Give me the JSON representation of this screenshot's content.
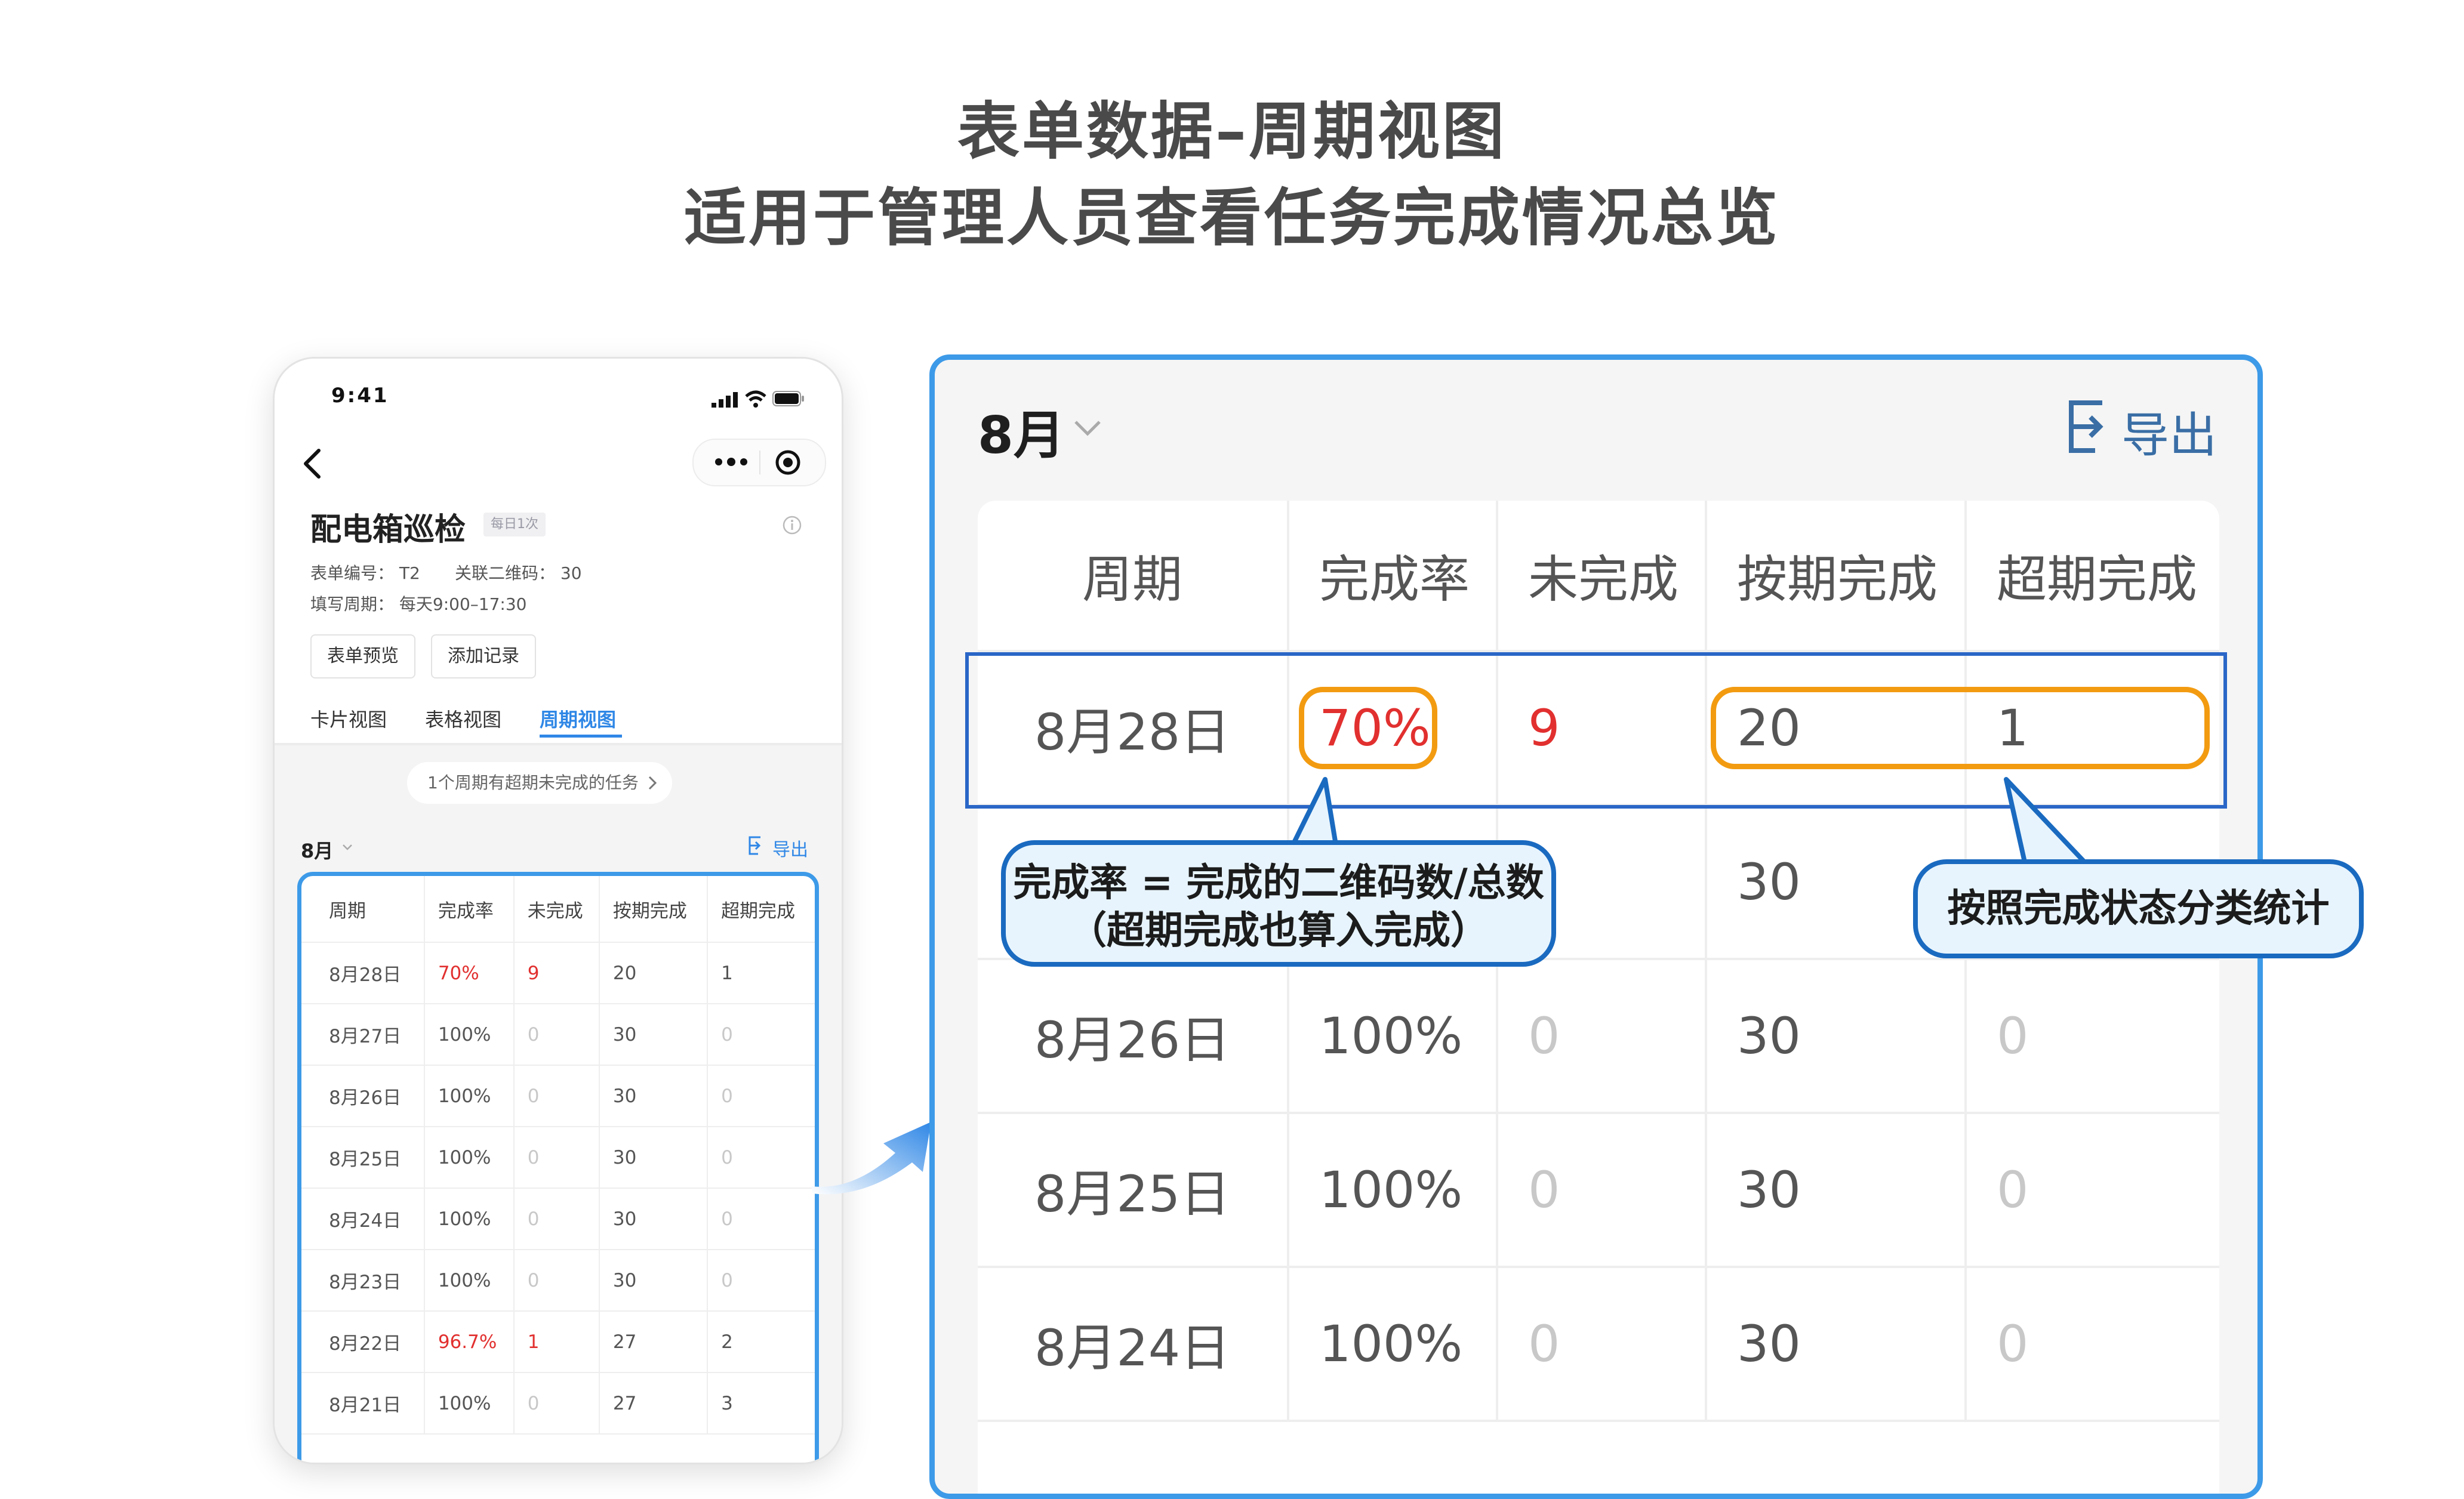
{
  "headline": {
    "line1": "表单数据–周期视图",
    "line2": "适用于管理人员查看任务完成情况总览"
  },
  "phone": {
    "status_time": "9:41",
    "form_title": "配电箱巡检",
    "frequency_badge": "每日1次",
    "form_number": "表单编号： T2",
    "linked_qr": "关联二维码： 30",
    "fill_period": "填写周期： 每天9:00–17:30",
    "buttons": {
      "preview": "表单预览",
      "add_record": "添加记录"
    },
    "tabs": [
      "卡片视图",
      "表格视图",
      "周期视图"
    ],
    "active_tab": "周期视图",
    "notice": "1个周期有超期未完成的任务",
    "month": "8月",
    "export": "导出",
    "table": {
      "headers": [
        "周期",
        "完成率",
        "未完成",
        "按期完成",
        "超期完成"
      ],
      "rows": [
        [
          "8月28日",
          "70%",
          "9",
          "20",
          "1"
        ],
        [
          "8月27日",
          "100%",
          "0",
          "30",
          "0"
        ],
        [
          "8月26日",
          "100%",
          "0",
          "30",
          "0"
        ],
        [
          "8月25日",
          "100%",
          "0",
          "30",
          "0"
        ],
        [
          "8月24日",
          "100%",
          "0",
          "30",
          "0"
        ],
        [
          "8月23日",
          "100%",
          "0",
          "30",
          "0"
        ],
        [
          "8月22日",
          "96.7%",
          "1",
          "27",
          "2"
        ],
        [
          "8月21日",
          "100%",
          "0",
          "27",
          "3"
        ]
      ]
    }
  },
  "panel": {
    "month": "8月",
    "export": "导出",
    "table": {
      "headers": [
        "周期",
        "完成率",
        "未完成",
        "按期完成",
        "超期完成"
      ],
      "rows": [
        [
          "8月28日",
          "70%",
          "9",
          "20",
          "1"
        ],
        [
          "",
          "",
          "",
          "30",
          ""
        ],
        [
          "8月26日",
          "100%",
          "0",
          "30",
          "0"
        ],
        [
          "8月25日",
          "100%",
          "0",
          "30",
          "0"
        ],
        [
          "8月24日",
          "100%",
          "0",
          "30",
          "0"
        ]
      ]
    }
  },
  "callouts": {
    "rate_line1": "完成率 = 完成的二维码数/总数",
    "rate_line2": "（超期完成也算入完成）",
    "status": "按照完成状态分类统计"
  },
  "colors": {
    "accent_blue": "#3d9ae8",
    "highlight_orange": "#f29b11",
    "alert_red": "#e1302f",
    "callout_border": "#1a6ac0",
    "callout_fill": "#e7f4fd"
  },
  "icons": [
    "back-icon",
    "more-icon",
    "target-icon",
    "signal-icon",
    "wifi-icon",
    "battery-icon",
    "info-icon",
    "chevron-down-icon",
    "chevron-right-icon",
    "export-icon",
    "arrow-icon"
  ]
}
